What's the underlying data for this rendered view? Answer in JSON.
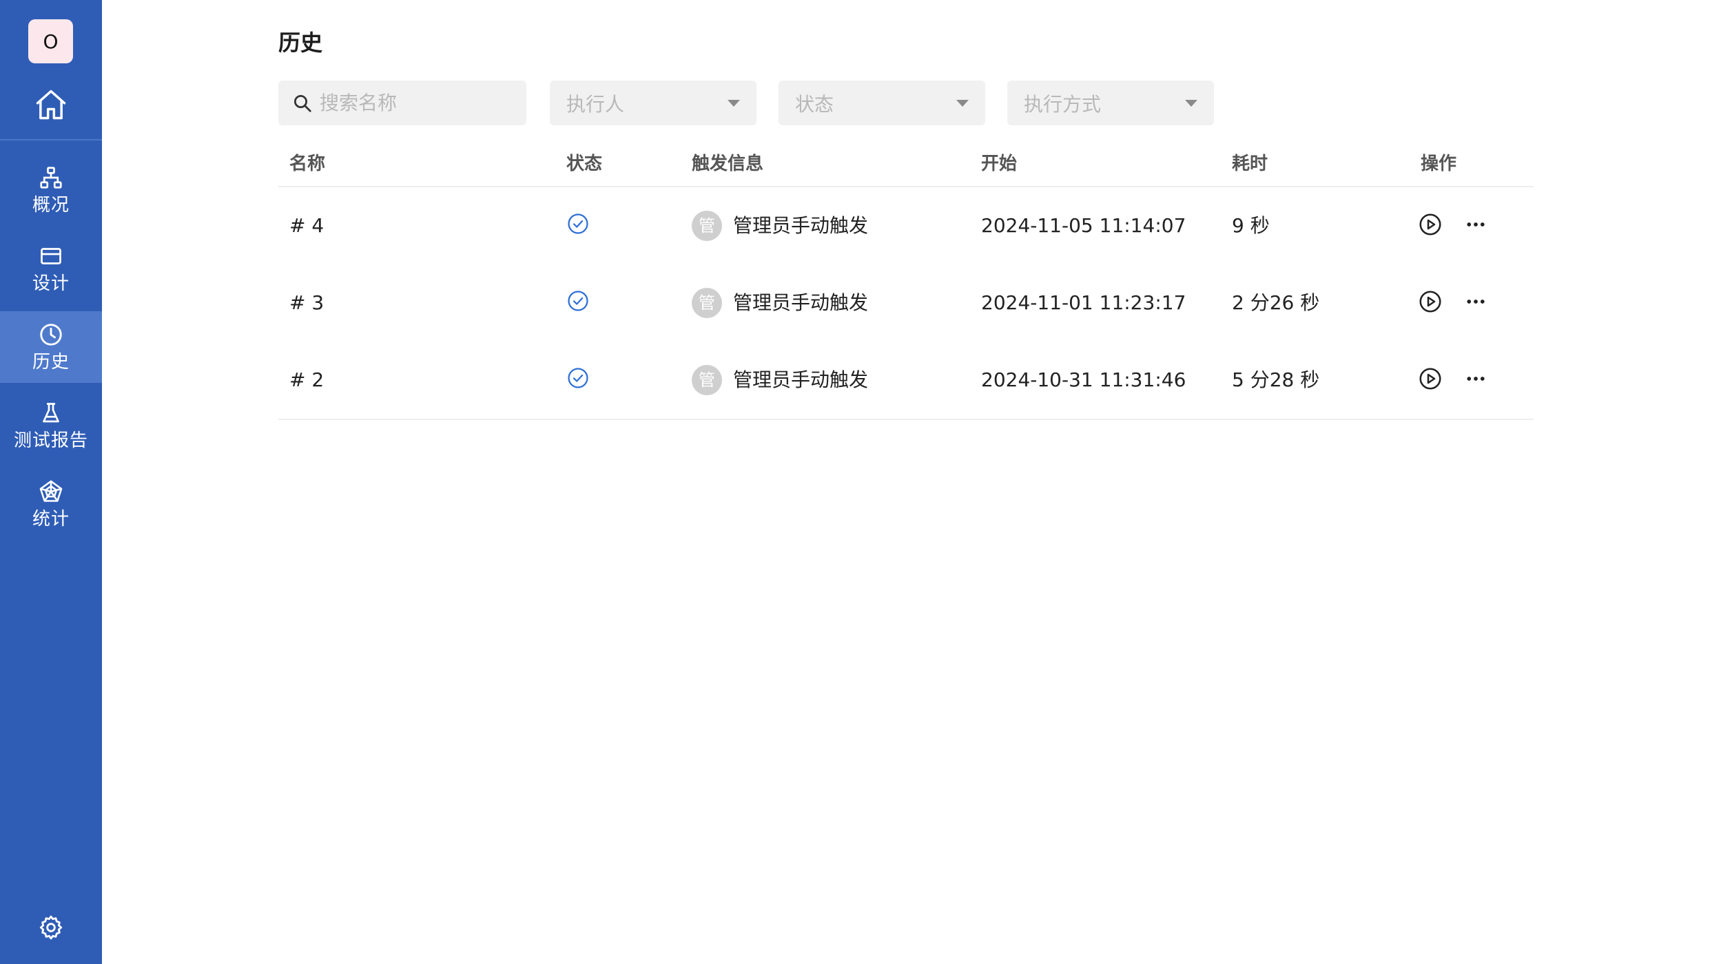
{
  "sidebar": {
    "avatar_letter": "O",
    "items": [
      {
        "label": "概况",
        "icon": "sitemap-icon",
        "active": false
      },
      {
        "label": "设计",
        "icon": "card-icon",
        "active": false
      },
      {
        "label": "历史",
        "icon": "clock-icon",
        "active": true
      },
      {
        "label": "测试报告",
        "icon": "flask-icon",
        "active": false
      },
      {
        "label": "统计",
        "icon": "radar-chart-icon",
        "active": false
      }
    ]
  },
  "page": {
    "title": "历史"
  },
  "filters": {
    "search_placeholder": "搜索名称",
    "executor_placeholder": "执行人",
    "status_placeholder": "状态",
    "mode_placeholder": "执行方式"
  },
  "table": {
    "columns": [
      "名称",
      "状态",
      "触发信息",
      "开始",
      "耗时",
      "操作"
    ],
    "rows": [
      {
        "name": "# 4",
        "status": "success",
        "trigger_avatar": "管",
        "trigger": "管理员手动触发",
        "start": "2024-11-05 11:14:07",
        "duration": "9 秒"
      },
      {
        "name": "# 3",
        "status": "success",
        "trigger_avatar": "管",
        "trigger": "管理员手动触发",
        "start": "2024-11-01 11:23:17",
        "duration": "2 分26 秒"
      },
      {
        "name": "# 2",
        "status": "success",
        "trigger_avatar": "管",
        "trigger": "管理员手动触发",
        "start": "2024-10-31 11:31:46",
        "duration": "5 分28 秒"
      }
    ]
  },
  "colors": {
    "sidebar": "#2f5db6",
    "sidebar_active": "#4f7acc",
    "accent": "#2f6fd6",
    "filter_bg": "#f1f1f1"
  }
}
